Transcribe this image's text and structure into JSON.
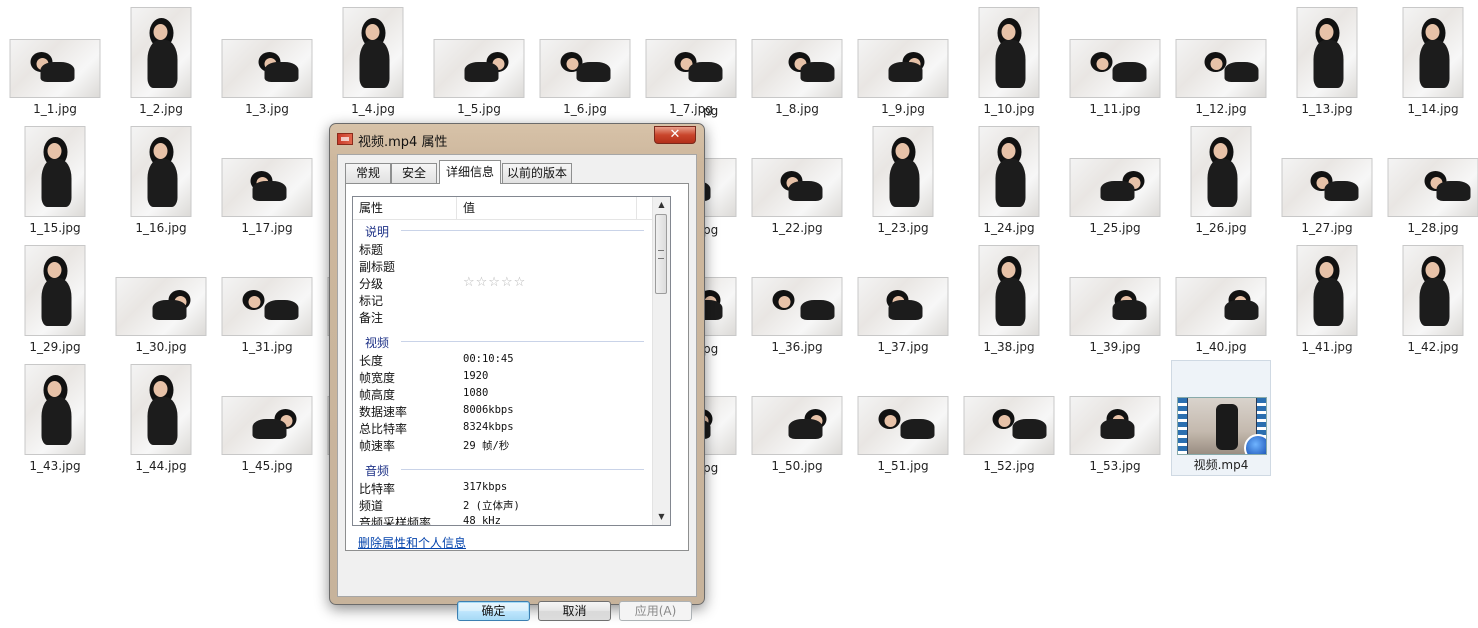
{
  "desktop": {
    "files": [
      {
        "name": "1_1.jpg",
        "orient": "land"
      },
      {
        "name": "1_2.jpg",
        "orient": "port"
      },
      {
        "name": "1_3.jpg",
        "orient": "land"
      },
      {
        "name": "1_4.jpg",
        "orient": "port"
      },
      {
        "name": "1_5.jpg",
        "orient": "land"
      },
      {
        "name": "1_6.jpg",
        "orient": "land"
      },
      {
        "name": "1_7.jpg",
        "orient": "land"
      },
      {
        "name": "1_8.jpg",
        "orient": "land"
      },
      {
        "name": "1_9.jpg",
        "orient": "land"
      },
      {
        "name": "1_10.jpg",
        "orient": "port"
      },
      {
        "name": "1_11.jpg",
        "orient": "land"
      },
      {
        "name": "1_12.jpg",
        "orient": "land"
      },
      {
        "name": "1_13.jpg",
        "orient": "port"
      },
      {
        "name": "1_14.jpg",
        "orient": "port"
      },
      {
        "name": "1_15.jpg",
        "orient": "port"
      },
      {
        "name": "1_16.jpg",
        "orient": "port"
      },
      {
        "name": "1_17.jpg",
        "orient": "land"
      },
      {
        "name": "",
        "orient": "port"
      },
      {
        "name": "",
        "orient": "land"
      },
      {
        "name": "",
        "orient": "land"
      },
      {
        "name": "",
        "orient": "land"
      },
      {
        "name": "1_22.jpg",
        "orient": "land"
      },
      {
        "name": "1_23.jpg",
        "orient": "port"
      },
      {
        "name": "1_24.jpg",
        "orient": "port"
      },
      {
        "name": "1_25.jpg",
        "orient": "land"
      },
      {
        "name": "1_26.jpg",
        "orient": "port"
      },
      {
        "name": "1_27.jpg",
        "orient": "land"
      },
      {
        "name": "1_28.jpg",
        "orient": "land"
      },
      {
        "name": "1_29.jpg",
        "orient": "port"
      },
      {
        "name": "1_30.jpg",
        "orient": "land"
      },
      {
        "name": "1_31.jpg",
        "orient": "land"
      },
      {
        "name": "",
        "orient": "land"
      },
      {
        "name": "",
        "orient": "land"
      },
      {
        "name": "",
        "orient": "land"
      },
      {
        "name": "",
        "orient": "land"
      },
      {
        "name": "1_36.jpg",
        "orient": "land"
      },
      {
        "name": "1_37.jpg",
        "orient": "land"
      },
      {
        "name": "1_38.jpg",
        "orient": "port"
      },
      {
        "name": "1_39.jpg",
        "orient": "land"
      },
      {
        "name": "1_40.jpg",
        "orient": "land"
      },
      {
        "name": "1_41.jpg",
        "orient": "port"
      },
      {
        "name": "1_42.jpg",
        "orient": "port"
      },
      {
        "name": "1_43.jpg",
        "orient": "port"
      },
      {
        "name": "1_44.jpg",
        "orient": "port"
      },
      {
        "name": "1_45.jpg",
        "orient": "land"
      },
      {
        "name": "",
        "orient": "land"
      },
      {
        "name": "",
        "orient": "land"
      },
      {
        "name": "",
        "orient": "land"
      },
      {
        "name": "",
        "orient": "land"
      },
      {
        "name": "1_50.jpg",
        "orient": "land"
      },
      {
        "name": "1_51.jpg",
        "orient": "land"
      },
      {
        "name": "1_52.jpg",
        "orient": "land"
      },
      {
        "name": "1_53.jpg",
        "orient": "land"
      },
      {
        "name": "视频.mp4",
        "orient": "video",
        "selected": true
      }
    ],
    "partial_labels": [
      "pg",
      "pg",
      "pg",
      "pg"
    ]
  },
  "dialog": {
    "title": "视频.mp4 属性",
    "close_label": "✕",
    "tabs": [
      "常规",
      "安全",
      "详细信息",
      "以前的版本"
    ],
    "active_tab": 2,
    "list": {
      "col_property": "属性",
      "col_value": "值",
      "groups": [
        {
          "name": "说明",
          "rows": [
            {
              "k": "标题",
              "v": ""
            },
            {
              "k": "副标题",
              "v": ""
            },
            {
              "k": "分级",
              "v": "",
              "stars": "☆☆☆☆☆"
            },
            {
              "k": "标记",
              "v": ""
            },
            {
              "k": "备注",
              "v": ""
            }
          ]
        },
        {
          "name": "视频",
          "rows": [
            {
              "k": "长度",
              "v": "00:10:45"
            },
            {
              "k": "帧宽度",
              "v": "1920"
            },
            {
              "k": "帧高度",
              "v": "1080"
            },
            {
              "k": "数据速率",
              "v": "8006kbps"
            },
            {
              "k": "总比特率",
              "v": "8324kbps"
            },
            {
              "k": "帧速率",
              "v": "29 帧/秒"
            }
          ]
        },
        {
          "name": "音频",
          "rows": [
            {
              "k": "比特率",
              "v": "317kbps"
            },
            {
              "k": "频道",
              "v": "2 (立体声)"
            },
            {
              "k": "音频采样频率",
              "v": "48 kHz"
            }
          ]
        }
      ]
    },
    "remove_link": "删除属性和个人信息",
    "buttons": {
      "ok": "确定",
      "cancel": "取消",
      "apply": "应用(A)"
    }
  }
}
